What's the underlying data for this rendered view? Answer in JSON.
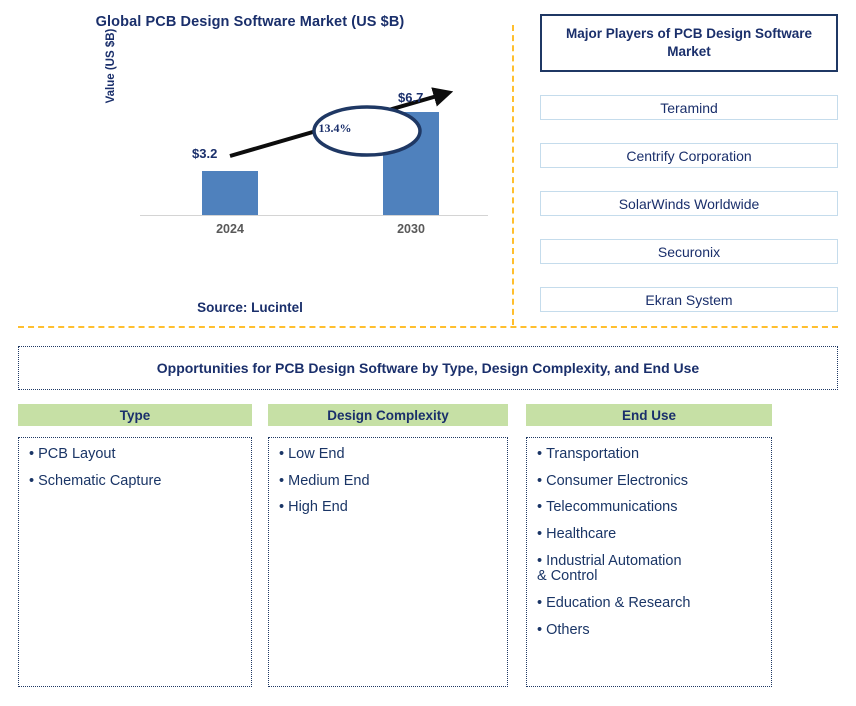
{
  "chart_panel": {
    "title": "Global PCB Design Software Market (US $B)",
    "y_axis_label": "Value (US $B)",
    "source": "Source: Lucintel"
  },
  "chart_data": {
    "type": "bar",
    "title": "Global PCB Design Software Market (US $B)",
    "categories": [
      "2024",
      "2030"
    ],
    "values": [
      3.2,
      6.7
    ],
    "value_labels": [
      "$3.2",
      "$6.7"
    ],
    "xlabel": "",
    "ylabel": "Value (US $B)",
    "ylim": [
      0,
      8
    ],
    "grid": false,
    "legend": null,
    "annotations": [
      {
        "label": "13.4%",
        "kind": "cagr-callout",
        "from": "2024",
        "to": "2030"
      }
    ],
    "series_color": "#4f81bd"
  },
  "players": {
    "header": "Major Players of PCB Design Software Market",
    "items": [
      "Teramind",
      "Centrify Corporation",
      "SolarWinds Worldwide",
      "Securonix",
      "Ekran System"
    ]
  },
  "opportunities": {
    "banner": "Opportunities for PCB Design Software by Type, Design Complexity, and End Use"
  },
  "columns": [
    {
      "header": "Type",
      "items": [
        "PCB Layout",
        "Schematic Capture"
      ]
    },
    {
      "header": "Design Complexity",
      "items": [
        "Low End",
        "Medium End",
        "High End"
      ]
    },
    {
      "header": "End Use",
      "items": [
        "Transportation",
        "Consumer Electronics",
        "Telecommunications",
        "Healthcare",
        "Industrial Automation\n& Control",
        "Education & Research",
        "Others"
      ]
    }
  ],
  "colors": {
    "bar": "#4f81bd",
    "navy_text": "#1a2f6b",
    "divider_orange": "#ffbf2e",
    "header_green": "#c6e0a5",
    "player_border": "#c5dcec"
  }
}
